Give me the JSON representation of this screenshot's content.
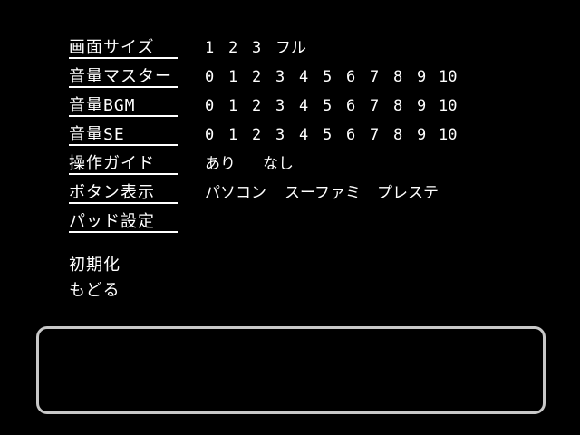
{
  "menu": {
    "screen_size": {
      "label": "画面サイズ",
      "options": [
        "1",
        "2",
        "3",
        "フル"
      ]
    },
    "volume_master": {
      "label": "音量マスター",
      "options": [
        "0",
        "1",
        "2",
        "3",
        "4",
        "5",
        "6",
        "7",
        "8",
        "9",
        "10"
      ]
    },
    "volume_bgm": {
      "label": "音量BGM",
      "options": [
        "0",
        "1",
        "2",
        "3",
        "4",
        "5",
        "6",
        "7",
        "8",
        "9",
        "10"
      ]
    },
    "volume_se": {
      "label": "音量SE",
      "options": [
        "0",
        "1",
        "2",
        "3",
        "4",
        "5",
        "6",
        "7",
        "8",
        "9",
        "10"
      ]
    },
    "control_guide": {
      "label": "操作ガイド",
      "options": [
        "あり",
        "なし"
      ]
    },
    "button_display": {
      "label": "ボタン表示",
      "options": [
        "パソコン",
        "スーファミ",
        "プレステ"
      ]
    },
    "pad_settings": {
      "label": "パッド設定"
    },
    "initialize": {
      "label": "初期化"
    },
    "back": {
      "label": "もどる"
    }
  },
  "message_box": {
    "text": ""
  }
}
